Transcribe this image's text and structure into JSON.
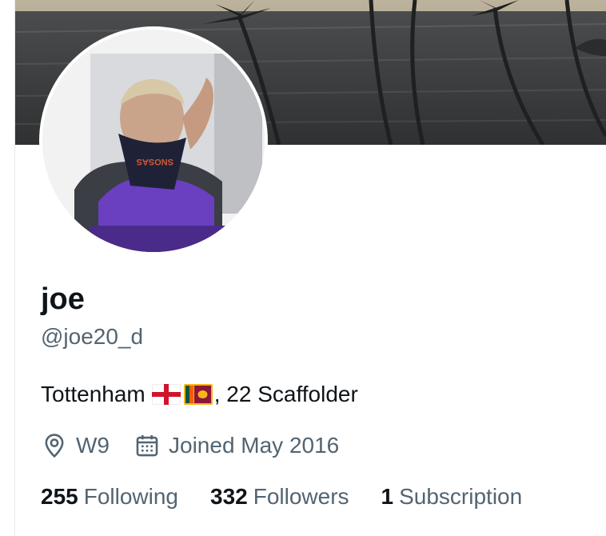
{
  "profile": {
    "display_name": "joe",
    "handle": "@joe20_d",
    "bio_before": "Tottenham",
    "bio_flags": [
      "england-flag",
      "sri-lanka-flag"
    ],
    "bio_after": ", 22 Scaffolder",
    "location": "W9",
    "joined": "Joined May 2016",
    "stats": {
      "following_count": "255",
      "following_label": "Following",
      "followers_count": "332",
      "followers_label": "Followers",
      "subscriptions_count": "1",
      "subscriptions_label": "Subscription"
    }
  },
  "icons": {
    "location": "location-pin-icon",
    "joined": "calendar-icon"
  },
  "colors": {
    "primary_text": "#0f1419",
    "secondary_text": "#536471",
    "border": "#e7e9ea"
  }
}
